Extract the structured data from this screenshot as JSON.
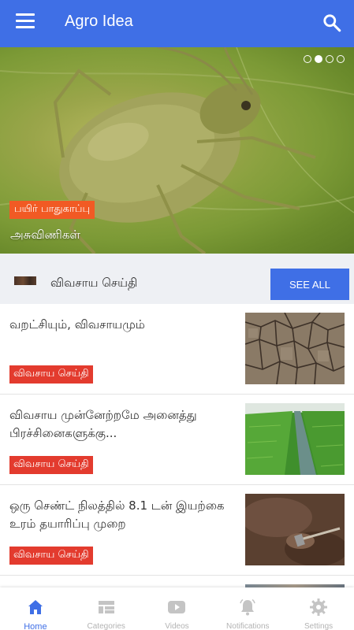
{
  "app": {
    "title": "Agro Idea"
  },
  "hero": {
    "category": "பயிர் பாதுகாப்பு",
    "caption": "அசுவிணிகள்",
    "slide_index": 2,
    "slide_count": 4
  },
  "section": {
    "label": "விவசாய செய்தி",
    "see_all": "SEE ALL"
  },
  "articles": [
    {
      "title": "வறட்சியும், விவசாயமும்",
      "category": "விவசாய செய்தி",
      "image": "cracked-dry-soil"
    },
    {
      "title": "விவசாய முன்னேற்றமே அனைத்து பிரச்சினைகளுக்கு...",
      "category": "விவசாய செய்தி",
      "image": "green-paddy-field"
    },
    {
      "title": "ஒரு செண்ட் நிலத்தில் 8.1 டன் இயற்கை உரம் தயாரிப்பு முறை",
      "category": "விவசாய செய்தி",
      "image": "soil-with-hoe"
    }
  ],
  "bottom_nav": [
    {
      "label": "Home",
      "icon": "home-icon",
      "active": true
    },
    {
      "label": "Categories",
      "icon": "categories-icon",
      "active": false
    },
    {
      "label": "Videos",
      "icon": "video-icon",
      "active": false
    },
    {
      "label": "Notifications",
      "icon": "bell-icon",
      "active": false
    },
    {
      "label": "Settings",
      "icon": "gear-icon",
      "active": false
    }
  ],
  "colors": {
    "primary": "#3f6fe6",
    "tag_orange": "#f15a24",
    "badge_red": "#e33b2e",
    "section_bg": "#eef0f4"
  }
}
